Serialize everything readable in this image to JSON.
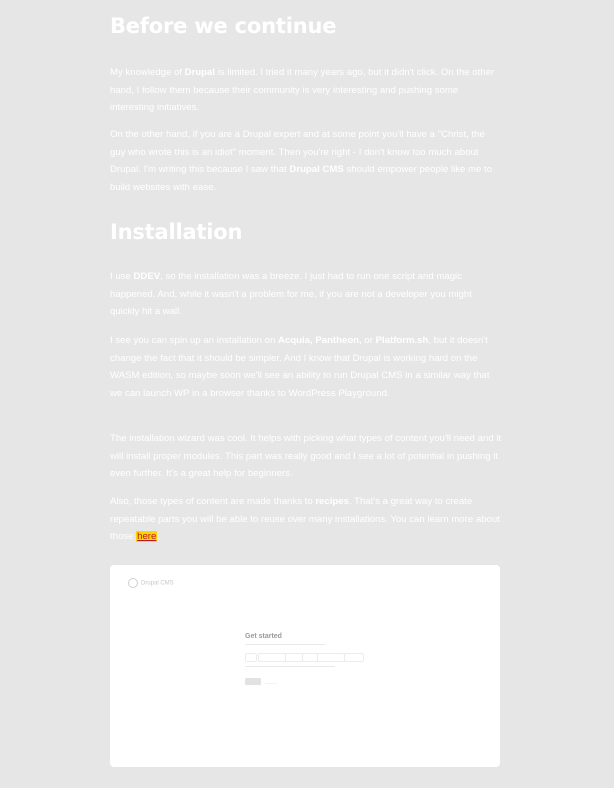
{
  "sections": {
    "before": {
      "title": "Before we continue",
      "p1": {
        "a": "My knowledge of ",
        "b1": "Drupal",
        "c": " is limited. I tried it many years ago, but it didn't click. On the other hand, I follow them because their community is very interesting and pushing some interesting initiatives."
      },
      "p2": {
        "a": "On the other hand, if you are a Drupal expert and at some point you'll have a \"Christ, the guy who wrote this is an idiot\" moment. Then you're right - I don't know too much about Drupal. I'm writing this because I saw that ",
        "b1": "Drupal CMS",
        "c": " should empower people like me to build websites with ease."
      }
    },
    "installation": {
      "title": "Installation",
      "p1": {
        "a": "I use ",
        "b1": "DDEV",
        "c": ", so the installation was a breeze. I just had to run one script and magic happened. And, while it wasn't a problem for me, if you are not a developer you might quickly hit a wall."
      },
      "p2": {
        "a": "I see you can spin up an installation on ",
        "b1": "Acquia, Pantheon,",
        "c": " or ",
        "b2": "Platform.sh",
        "d": ", but it doesn't change the fact that it should be simpler. And I know that Drupal is working hard on the WASM edition, so maybe soon we'll see an ability to run Drupal CMS in a similar way that we can launch WP in a browser thanks to WordPress Playground."
      },
      "p3": "The installation wizard was cool. It helps with picking what types of content you'll need and it will install proper modules. This part was really good and I see a lot of potential in pushing it even further. It's a great help for beginners.",
      "p4": {
        "a": "Also, those types of content are made thanks to ",
        "b1": "recipes",
        "c": ". That's a great way to create repeatable parts you will be able to reuse over many installations. You can learn more about those ",
        "link": "here",
        "d": "."
      }
    }
  },
  "screenshot": {
    "logo": "Drupal CMS",
    "heading": "Get started"
  }
}
